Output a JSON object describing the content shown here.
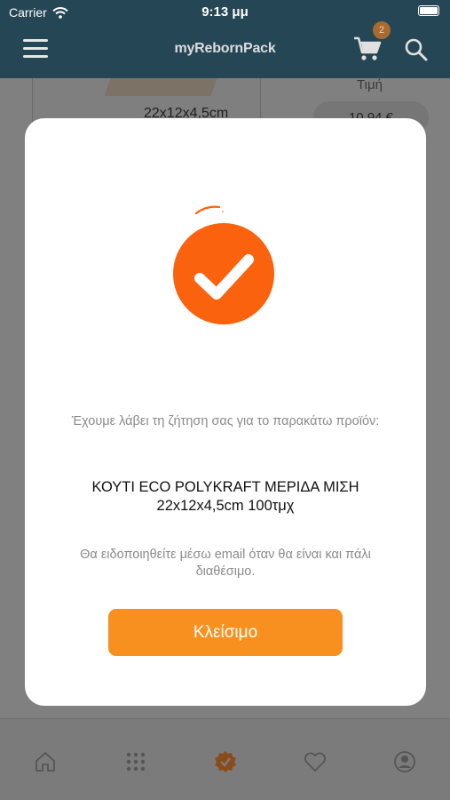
{
  "status_bar": {
    "carrier": "Carrier",
    "time": "9:13 μμ"
  },
  "header": {
    "brand": "myRebornPack",
    "cart_count": "2"
  },
  "background": {
    "size": "22x12x4,5cm",
    "price_label": "Τιμή",
    "price": "10,94 €"
  },
  "modal": {
    "message": "Έχουμε λάβει τη ζήτηση σας για το παρακάτω προϊόν:",
    "product_line1": "ΚΟΥΤΙ ECO POLYKRAFT ΜΕΡΙΔΑ ΜΙΣΗ",
    "product_line2": "22x12x4,5cm 100τμχ",
    "notify": "Θα ειδοποιηθείτε μέσω email όταν θα είναι και πάλι διαθέσιμο.",
    "close_label": "Κλείσιμο"
  },
  "colors": {
    "accent": "#fa620d",
    "button": "#f7901e",
    "header": "#244655"
  },
  "icons": [
    "menu-icon",
    "cart-icon",
    "search-icon",
    "home-icon",
    "grid-icon",
    "badge-check-icon",
    "heart-icon",
    "account-icon",
    "check-icon",
    "wifi-icon",
    "battery-icon"
  ]
}
